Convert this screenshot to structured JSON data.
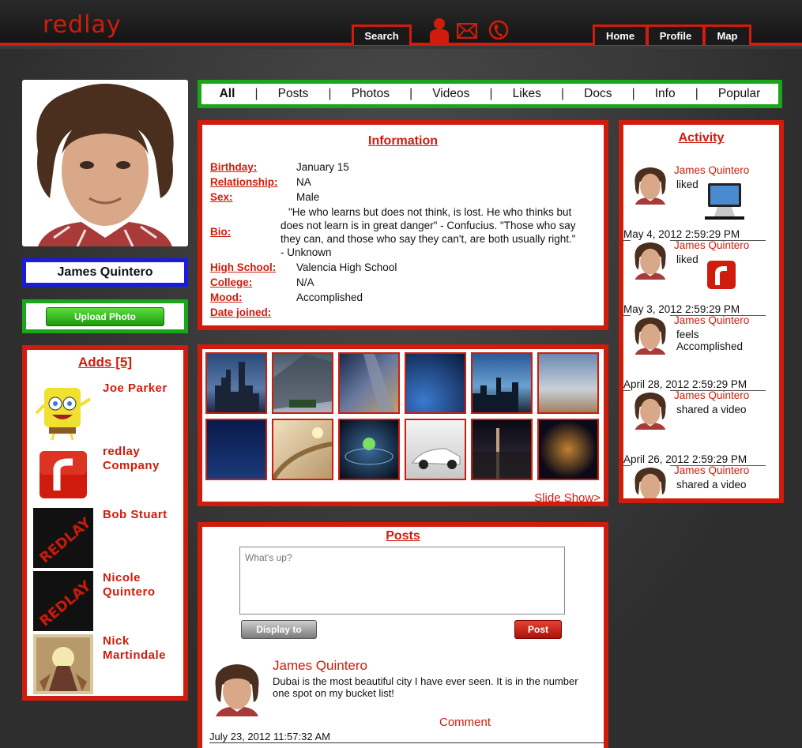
{
  "header": {
    "logo": "redlay",
    "search_label": "Search",
    "nav": {
      "home": "Home",
      "profile": "Profile",
      "map": "Map"
    },
    "icons": [
      "person-icon",
      "mail-icon",
      "phone-icon"
    ]
  },
  "profile": {
    "name": "James Quintero",
    "upload_label": "Upload Photo"
  },
  "adds": {
    "title": "Adds [5]",
    "items": [
      {
        "name": "Joe Parker"
      },
      {
        "name": "redlay Company"
      },
      {
        "name": "Bob Stuart"
      },
      {
        "name": "Nicole Quintero"
      },
      {
        "name": "Nick Martindale"
      }
    ]
  },
  "filters": {
    "tabs": [
      "All",
      "Posts",
      "Photos",
      "Videos",
      "Likes",
      "Docs",
      "Info",
      "Popular"
    ],
    "separator": "|"
  },
  "information": {
    "title": "Information",
    "birthday_label": "Birthday:",
    "birthday": "January 15",
    "relationship_label": "Relationship:",
    "relationship": "NA",
    "sex_label": "Sex:",
    "sex": "Male",
    "bio_label": "Bio:",
    "bio": "\"He who learns but does not think, is lost. He who thinks but does not learn is in great danger\" - Confucius. \"Those who say they can, and those who say they can't, are both usually right.\" - Unknown",
    "highschool_label": "High School:",
    "highschool": "Valencia High School",
    "college_label": "College:",
    "college": "N/A",
    "mood_label": "Mood:",
    "mood": "Accomplished",
    "joined_label": "Date joined:",
    "joined": ""
  },
  "gallery": {
    "slideshow_label": "Slide Show>"
  },
  "posts": {
    "title": "Posts",
    "placeholder": "What's up?",
    "display_label": "Display to",
    "post_label": "Post",
    "post": {
      "author": "James Quintero",
      "text": "Dubai is the most beautiful city I have ever seen. It is in the number one spot on my bucket list!",
      "comment_label": "Comment",
      "date": "July 23, 2012 11:57:32 AM"
    }
  },
  "activity": {
    "title": "Activity",
    "items": [
      {
        "name": "James Quintero",
        "text": "liked",
        "date": "May 4, 2012 2:59:29 PM"
      },
      {
        "name": "James Quintero",
        "text": "liked",
        "date": "May 3, 2012 2:59:29 PM"
      },
      {
        "name": "James Quintero",
        "text": "feels Accomplished",
        "date": "April 28, 2012 2:59:29 PM"
      },
      {
        "name": "James Quintero",
        "text": "shared a video",
        "date": "April 26, 2012 2:59:29 PM"
      },
      {
        "name": "James Quintero",
        "text": "shared a video",
        "date": ""
      }
    ]
  },
  "colors": {
    "accent": "#d01c0c",
    "green": "#1aa51a",
    "blue": "#1a1ae0"
  }
}
